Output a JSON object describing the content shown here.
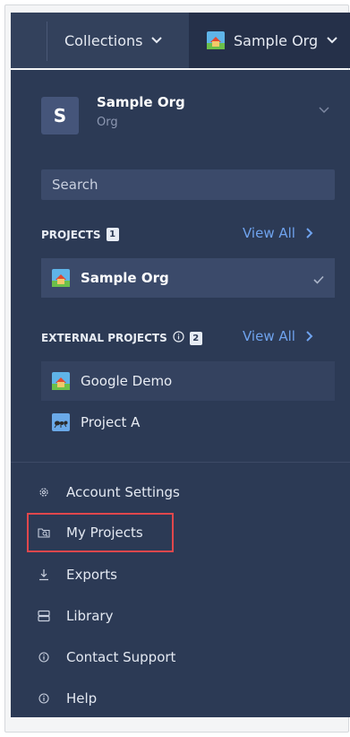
{
  "topbar": {
    "collections_label": "Collections",
    "org_label": "Sample Org"
  },
  "org_switcher": {
    "avatar_letter": "S",
    "name": "Sample Org",
    "type": "Org"
  },
  "search": {
    "placeholder": "Search"
  },
  "projects": {
    "section_label": "PROJECTS",
    "count": "1",
    "view_all": "View All",
    "items": [
      {
        "name": "Sample Org",
        "selected": true,
        "icon": "house-image-icon"
      }
    ]
  },
  "external_projects": {
    "section_label": "EXTERNAL PROJECTS",
    "count": "2",
    "view_all": "View All",
    "items": [
      {
        "name": "Google Demo",
        "icon": "house-image-icon"
      },
      {
        "name": "Project A",
        "icon": "ant-image-icon"
      }
    ]
  },
  "menu": {
    "items": [
      {
        "label": "Account Settings",
        "icon": "gear-icon"
      },
      {
        "label": "My Projects",
        "icon": "folder-search-icon"
      },
      {
        "label": "Exports",
        "icon": "download-icon"
      },
      {
        "label": "Library",
        "icon": "library-icon"
      },
      {
        "label": "Contact Support",
        "icon": "info-icon"
      },
      {
        "label": "Help",
        "icon": "info-icon"
      }
    ]
  },
  "colors": {
    "topbar": "#33415c",
    "panel": "#2c3a55",
    "link": "#6fa3ee",
    "highlight": "#e0474c"
  }
}
